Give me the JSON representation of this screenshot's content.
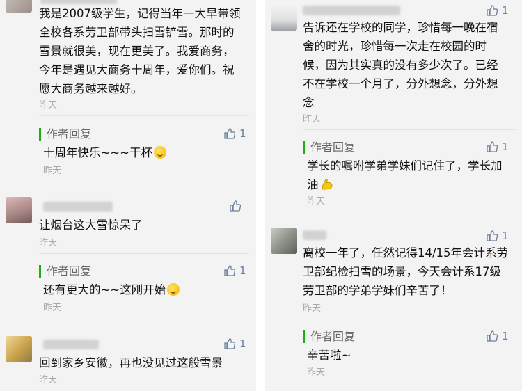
{
  "left": {
    "comments": [
      {
        "text": "我是2007级学生，记得当年一大早带领全校各系劳卫部带头扫雪铲雪。那时的雪景就很美，现在更美了。我爱商务，今年是遇见大商务十周年，爱你们。祝愿大商务越来越好。",
        "time": "昨天",
        "reply": {
          "label": "作者回复",
          "text": "十周年快乐~~~干杯",
          "time": "昨天",
          "likes": "1"
        }
      },
      {
        "text": "让烟台这大雪惊呆了",
        "time": "昨天",
        "reply": {
          "label": "作者回复",
          "text": "还有更大的~~这刚开始",
          "time": "昨天",
          "likes": "1"
        }
      },
      {
        "text": "回到家乡安徽，再也没见过这般雪景",
        "time": "昨天",
        "likes": "1"
      }
    ]
  },
  "right": {
    "comments": [
      {
        "text": "告诉还在学校的同学，珍惜每一晚在宿舍的时光，珍惜每一次走在校园的时候，因为其实真的没有多少次了。已经不在学校一个月了，分外想念，分外想念",
        "time": "昨天",
        "likes": "1",
        "reply": {
          "label": "作者回复",
          "text": "学长的嘱咐学弟学妹们记住了，学长加油",
          "time": "昨天",
          "likes": "1"
        }
      },
      {
        "text": "离校一年了，任然记得14/15年会计系劳卫部纪检扫雪的场景，今天会计系17级劳卫部的学弟学妹们辛苦了！",
        "time": "昨天",
        "likes": "1",
        "reply": {
          "label": "作者回复",
          "text": "辛苦啦~",
          "time": "昨天",
          "likes": "1"
        }
      }
    ]
  },
  "colors": {
    "accent_green": "#1aad19",
    "like_blue": "#6a7f9a",
    "muted": "#a8a8a8"
  }
}
